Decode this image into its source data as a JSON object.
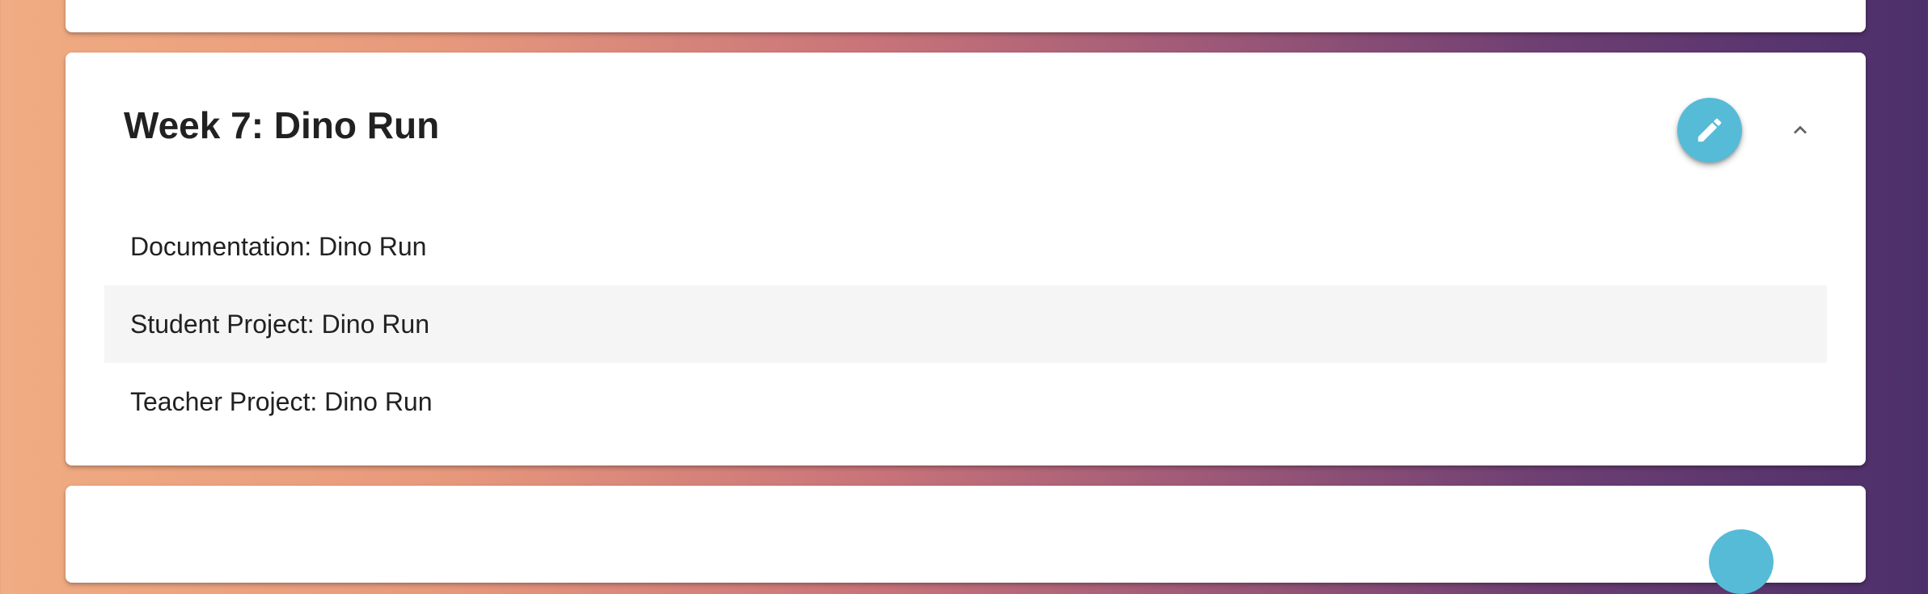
{
  "week": {
    "title": "Week 7: Dino Run",
    "items": [
      {
        "label": "Documentation: Dino Run",
        "highlighted": false
      },
      {
        "label": "Student Project: Dino Run",
        "highlighted": true
      },
      {
        "label": "Teacher Project: Dino Run",
        "highlighted": false
      }
    ],
    "edit_icon": "pencil-icon",
    "collapse_icon": "chevron-up-icon"
  },
  "colors": {
    "fab": "#56bbd6",
    "highlight_row": "#f5f5f5",
    "gradient_start": "#f0ac82",
    "gradient_end": "#4c2f6a"
  }
}
